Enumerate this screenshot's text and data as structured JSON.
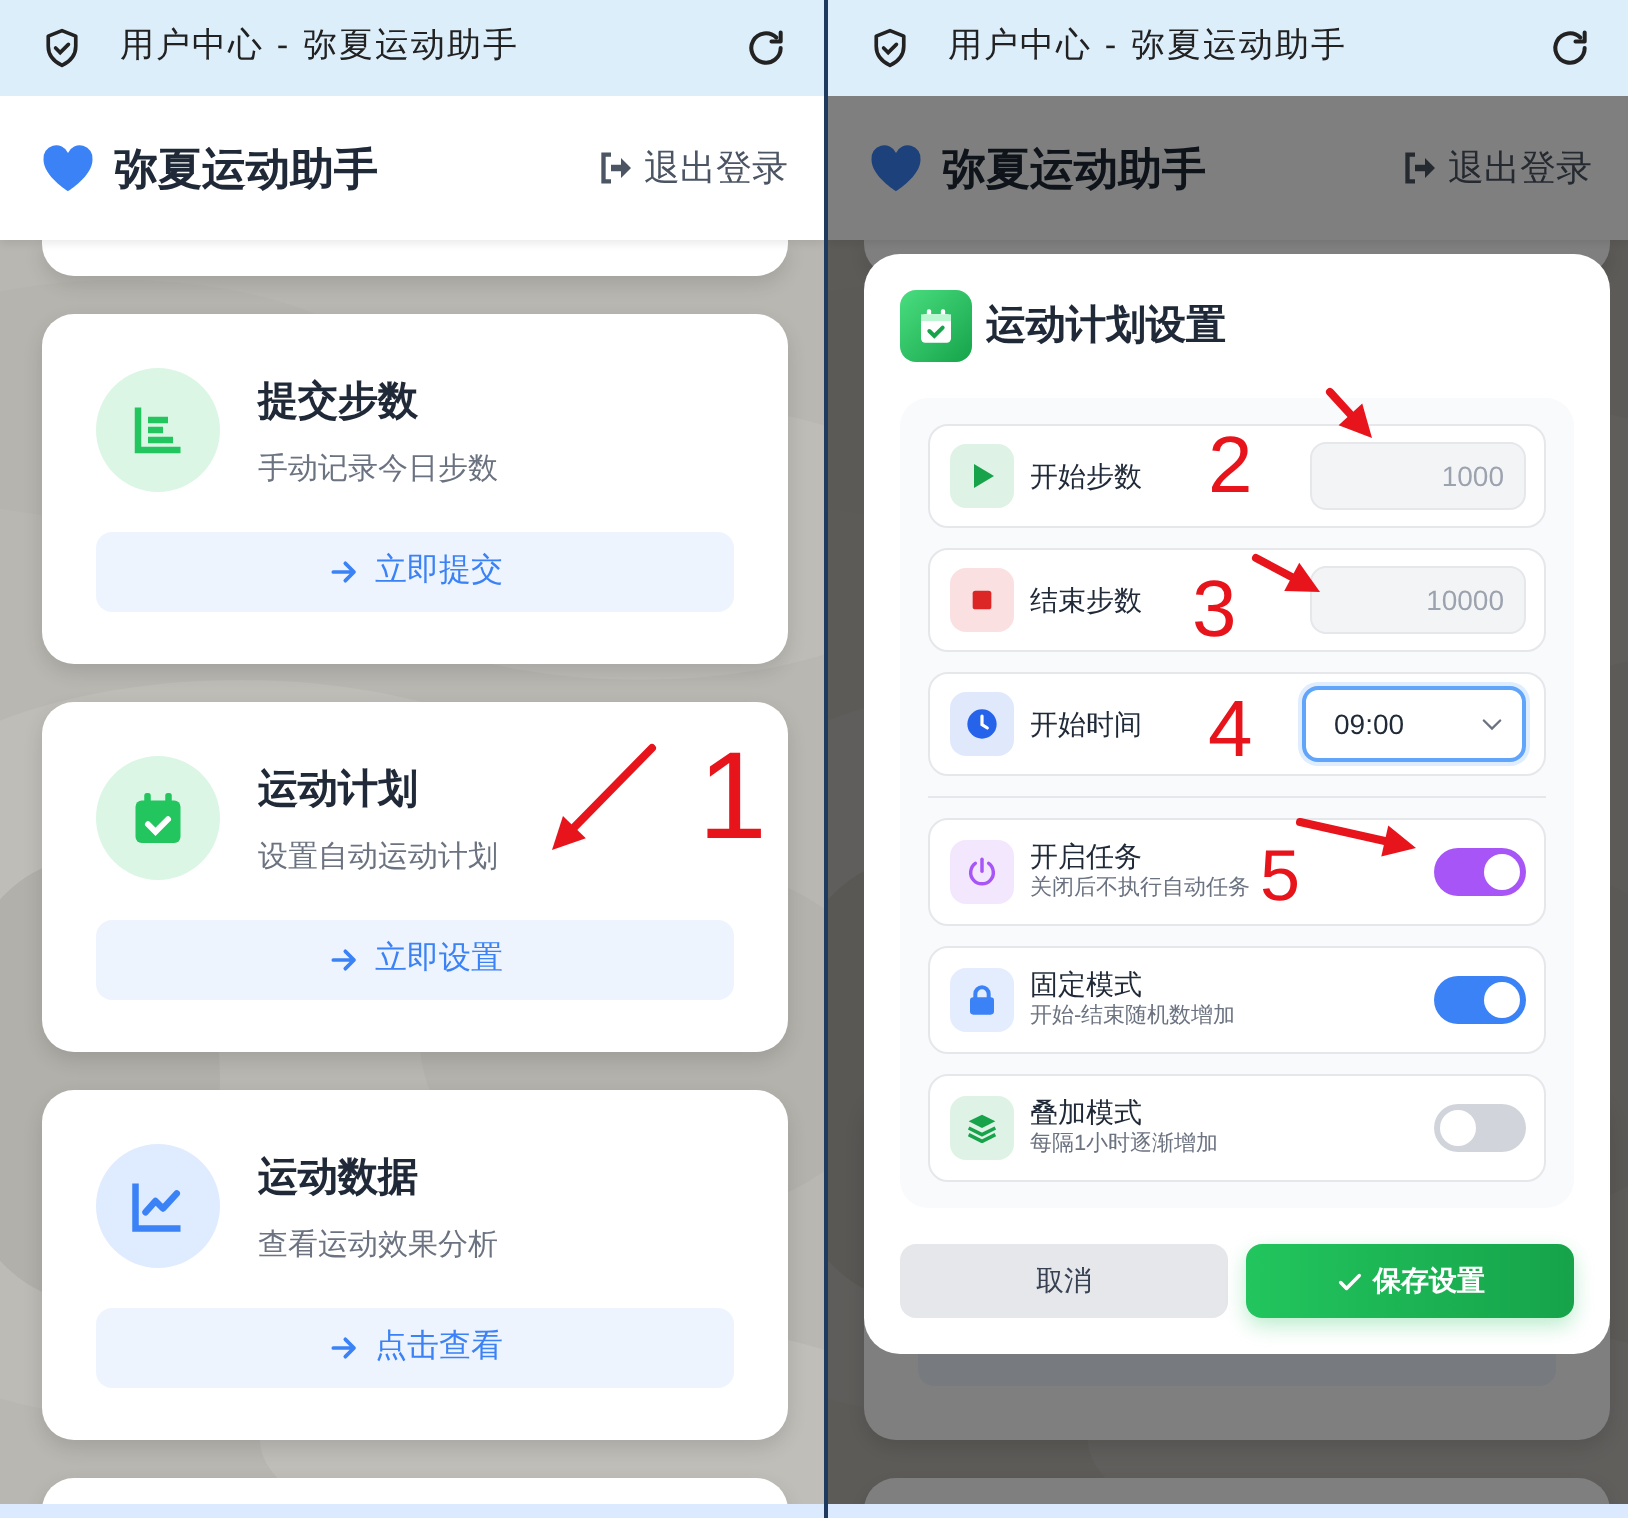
{
  "screens": [
    {
      "title_bar": {
        "title": "用户中心 - 弥夏运动助手"
      },
      "header": {
        "app_name": "弥夏运动助手",
        "logout": "退出登录"
      },
      "dimmed": false,
      "cards": [
        {
          "kind": "stub"
        },
        {
          "kind": "feature",
          "title": "提交步数",
          "subtitle": "手动记录今日步数",
          "action": "立即提交",
          "color": "#22c55e"
        },
        {
          "kind": "feature",
          "title": "运动计划",
          "subtitle": "设置自动运动计划",
          "action": "立即设置",
          "color": "#22c55e"
        },
        {
          "kind": "feature",
          "title": "运动数据",
          "subtitle": "查看运动效果分析",
          "action": "点击查看",
          "color": "#3b82f6"
        },
        {
          "kind": "edge"
        }
      ]
    },
    {
      "title_bar": {
        "title": "用户中心 - 弥夏运动助手"
      },
      "header": {
        "app_name": "弥夏运动助手",
        "logout": "退出登录"
      },
      "dimmed": true,
      "cards": [
        {
          "kind": "stub"
        },
        {
          "kind": "blank"
        },
        {
          "kind": "edge"
        }
      ],
      "dialog": {
        "title": "运动计划设置",
        "fields": [
          {
            "kind": "number",
            "label": "开始步数",
            "placeholder": "1000",
            "color": "#16a34a"
          },
          {
            "kind": "number",
            "label": "结束步数",
            "placeholder": "10000",
            "color": "#dc2626"
          },
          {
            "kind": "select",
            "label": "开始时间",
            "value": "09:00",
            "focused": true,
            "color": "#2563eb"
          }
        ],
        "switches": [
          {
            "label": "开启任务",
            "hint": "关闭后不执行自动任务",
            "on": true,
            "color": "#a855f7"
          },
          {
            "label": "固定模式",
            "hint": "开始-结束随机数增加",
            "on": true,
            "color": "#3b82f6"
          },
          {
            "label": "叠加模式",
            "hint": "每隔1小时逐渐增加",
            "on": false,
            "color": "#16a34a"
          }
        ],
        "buttons": [
          {
            "kind": "secondary",
            "label": "取消"
          },
          {
            "kind": "primary",
            "label": "保存设置"
          }
        ]
      }
    }
  ],
  "annotations": [
    {
      "label": "1"
    },
    {
      "label": "2"
    },
    {
      "label": "3"
    },
    {
      "label": "4"
    },
    {
      "label": "5"
    }
  ]
}
